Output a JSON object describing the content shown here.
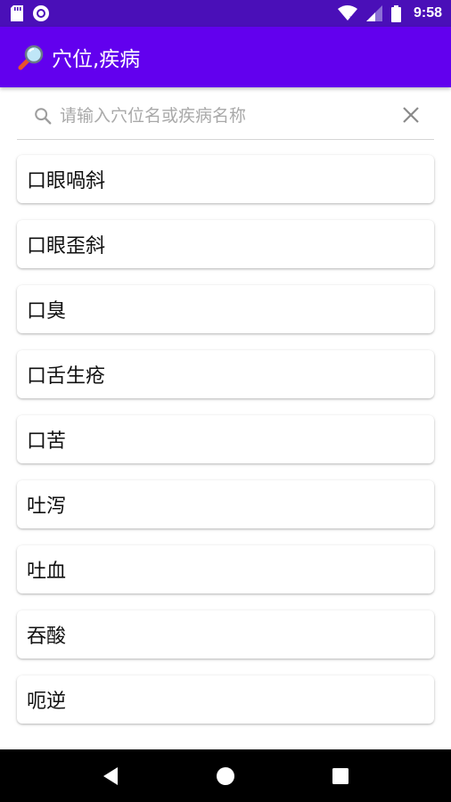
{
  "status_bar": {
    "time": "9:58"
  },
  "app_bar": {
    "title": "穴位,疾病",
    "icon": "magnifier-icon"
  },
  "search": {
    "placeholder": "请输入穴位名或疾病名称",
    "value": ""
  },
  "list": {
    "items": [
      {
        "label": "口眼喎斜"
      },
      {
        "label": "口眼歪斜"
      },
      {
        "label": "口臭"
      },
      {
        "label": "口舌生疮"
      },
      {
        "label": "口苦"
      },
      {
        "label": "吐泻"
      },
      {
        "label": "吐血"
      },
      {
        "label": "吞酸"
      },
      {
        "label": "呃逆"
      }
    ]
  },
  "colors": {
    "status_bar": "#4a0fb8",
    "app_bar": "#6200ee",
    "nav_bar": "#000000"
  }
}
